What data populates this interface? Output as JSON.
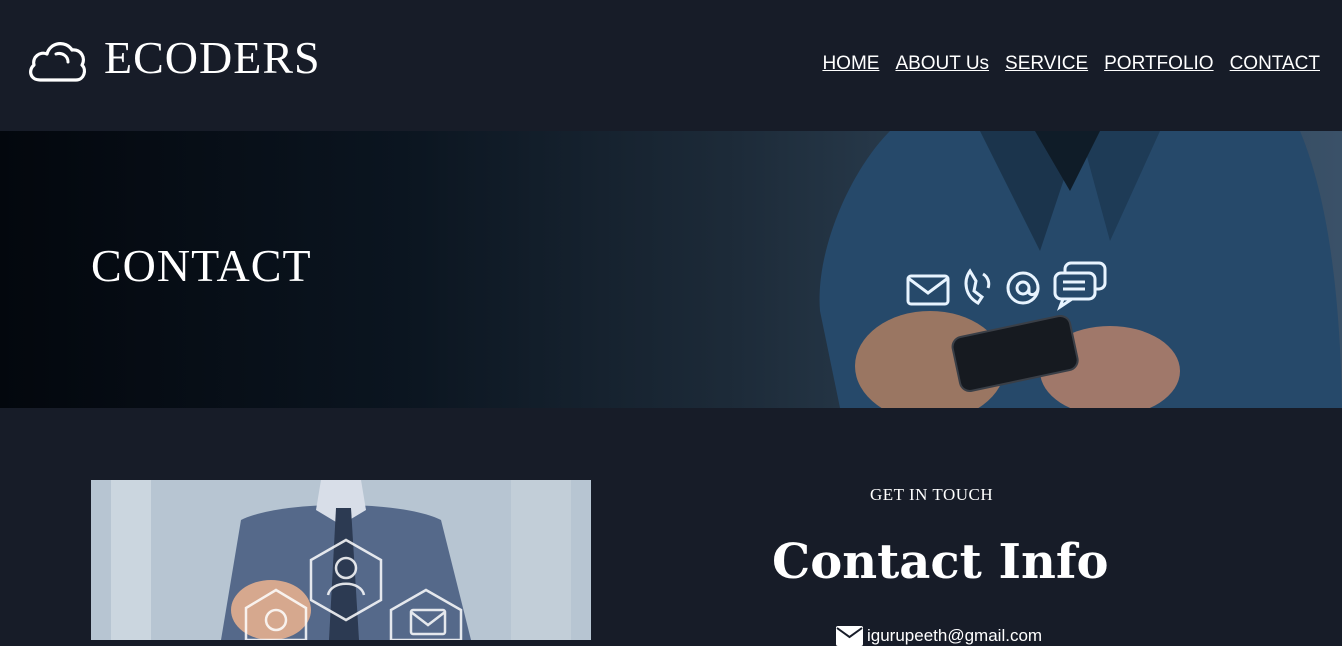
{
  "brand": {
    "name": "ECODERS",
    "logo_icon": "cloud-icon"
  },
  "nav": {
    "items": [
      {
        "label": "HOME"
      },
      {
        "label": "ABOUT Us"
      },
      {
        "label": "SERVICE"
      },
      {
        "label": "PORTFOLIO"
      },
      {
        "label": "CONTACT"
      }
    ]
  },
  "banner": {
    "title": "CONTACT"
  },
  "contact": {
    "kicker": "GET IN TOUCH",
    "heading": "Contact Info",
    "email": "igurupeeth@gmail.com",
    "email_icon": "envelope-icon"
  },
  "colors": {
    "background": "#171c28",
    "text": "#ffffff"
  }
}
